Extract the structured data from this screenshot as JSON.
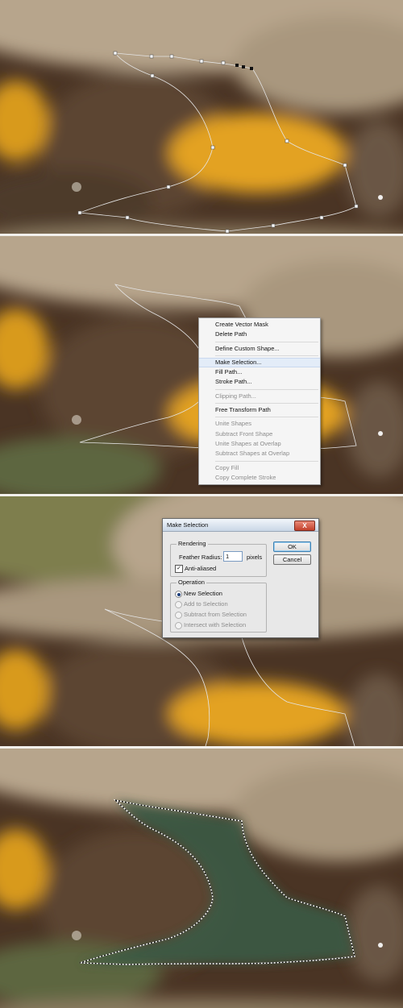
{
  "context_menu": {
    "items": [
      {
        "label": "Create Vector Mask",
        "enabled": true
      },
      {
        "label": "Delete Path",
        "enabled": true
      },
      {
        "separator": true
      },
      {
        "label": "Define Custom Shape...",
        "enabled": true
      },
      {
        "separator": true
      },
      {
        "label": "Make Selection...",
        "enabled": true,
        "highlighted": true
      },
      {
        "label": "Fill Path...",
        "enabled": true
      },
      {
        "label": "Stroke Path...",
        "enabled": true
      },
      {
        "separator": true
      },
      {
        "label": "Clipping Path...",
        "enabled": false
      },
      {
        "separator": true
      },
      {
        "label": "Free Transform Path",
        "enabled": true
      },
      {
        "separator": true
      },
      {
        "label": "Unite Shapes",
        "enabled": false
      },
      {
        "label": "Subtract Front Shape",
        "enabled": false
      },
      {
        "label": "Unite Shapes at Overlap",
        "enabled": false
      },
      {
        "label": "Subtract Shapes at Overlap",
        "enabled": false
      },
      {
        "separator": true
      },
      {
        "label": "Copy Fill",
        "enabled": false
      },
      {
        "label": "Copy Complete Stroke",
        "enabled": false
      }
    ]
  },
  "dialog": {
    "title": "Make Selection",
    "close_label": "X",
    "rendering": {
      "label": "Rendering",
      "feather_label": "Feather Radius:",
      "feather_value": "1",
      "feather_unit": "pixels",
      "anti_aliased_label": "Anti-aliased",
      "anti_aliased_checked": true
    },
    "operation": {
      "label": "Operation",
      "options": [
        {
          "label": "New Selection",
          "selected": true,
          "enabled": true
        },
        {
          "label": "Add to Selection",
          "selected": false,
          "enabled": false
        },
        {
          "label": "Subtract from Selection",
          "selected": false,
          "enabled": false
        },
        {
          "label": "Intersect with Selection",
          "selected": false,
          "enabled": false
        }
      ]
    },
    "ok_label": "OK",
    "cancel_label": "Cancel"
  },
  "colors": {
    "path_stroke": "#e4e4e4",
    "selection_fill": "#3a5a45",
    "accent": "#3c7fb1",
    "eye_yellow": "#e7a320"
  }
}
